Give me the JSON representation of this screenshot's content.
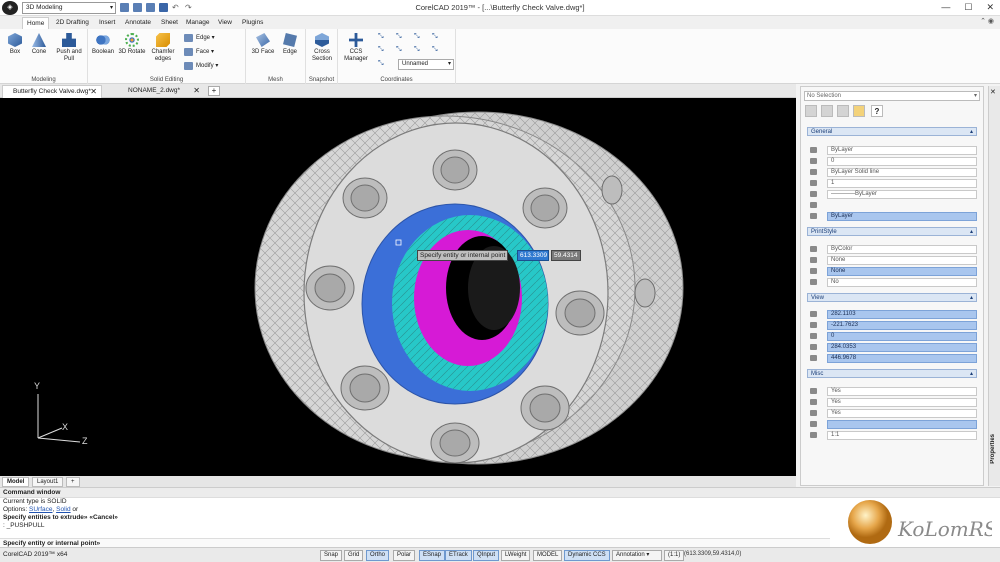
{
  "titlebar": {
    "workspace": "3D Modeling",
    "title": "CorelCAD 2019™ - [...\\Butterfly Check Valve.dwg*]",
    "minimize": "—",
    "maximize": "☐",
    "close": "✕"
  },
  "ribbon_tabs": [
    "Home",
    "2D Drafting",
    "Insert",
    "Annotate",
    "Sheet",
    "Manage",
    "View",
    "Plugins"
  ],
  "ribbon_ctrl": "⌃ ◉",
  "ribbon": {
    "modeling": {
      "label": "Modeling",
      "box": "Box",
      "cone": "Cone",
      "push": "Push and Pull"
    },
    "solid_editing": {
      "label": "Solid Editing",
      "boolean": "Boolean",
      "rotate": "3D Rotate",
      "chamfer": "Chamfer edges",
      "edge": "Edge",
      "face": "Face",
      "modify": "Modify"
    },
    "mesh": {
      "label": "Mesh",
      "face3d": "3D Face",
      "edge": "Edge"
    },
    "snapshot": {
      "label": "Snapshot",
      "cross": "Cross Section"
    },
    "coordinates": {
      "label": "Coordinates",
      "ccs": "CCS Manager",
      "ucs_value": "Unnamed"
    }
  },
  "doc_tabs": [
    {
      "label": "Butterfly Check Valve.dwg*",
      "close": "✕"
    },
    {
      "label": "NONAME_2.dwg*",
      "close": "✕"
    }
  ],
  "plus": "+",
  "viewport": {
    "tooltip": "Specify entity or internal point",
    "coord_x": "613.3309",
    "coord_y": "59.4314",
    "axis_x": "X",
    "axis_y": "Y",
    "axis_z": "Z"
  },
  "layout_tabs": [
    "Model",
    "Layout1",
    "+"
  ],
  "command": {
    "title": "Command window",
    "l1": "Current type is SOLID",
    "l2_prefix": "Options: ",
    "l2_a": "SUrface",
    "l2_sep": ", ",
    "l2_b": "Solid",
    "l2_suffix": " or",
    "l3": "Specify entities to extrude» «Cancel»",
    "l4": ": _PUSHPULL",
    "prompt": "Specify entity or internal point»"
  },
  "status": {
    "app": "CorelCAD 2019™ x64",
    "buttons": [
      "Snap",
      "Grid",
      "Ortho",
      "Polar",
      "ESnap",
      "ETrack",
      "QInput",
      "LWeight",
      "MODEL",
      "Dynamic CCS",
      "Annotation"
    ],
    "on": [
      "Ortho",
      "ESnap",
      "ETrack",
      "QInput",
      "Dynamic CCS"
    ],
    "scale": "(1:1)",
    "coords": "(613.3309,59.4314,0)"
  },
  "properties": {
    "selection": "No Selection",
    "sections": {
      "general": "General",
      "printstyle": "PrintStyle",
      "view": "View",
      "misc": "Misc"
    },
    "general": [
      "ByLayer",
      "0",
      "ByLayer     Solid line",
      "1",
      "————ByLayer",
      "",
      "ByLayer"
    ],
    "printstyle": [
      "ByColor",
      "None",
      "None",
      "No"
    ],
    "view": [
      "282.1103",
      "-221.7623",
      "0",
      "284.0353",
      "446.9678"
    ],
    "misc": [
      "Yes",
      "Yes",
      "Yes",
      "",
      "1:1"
    ],
    "side_label": "Properties",
    "close": "✕"
  },
  "watermark": "KoLomRS"
}
